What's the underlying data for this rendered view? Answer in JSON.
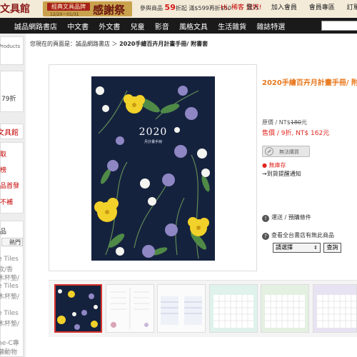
{
  "topbar": {
    "logo_fragment": "文具館",
    "event_ribbon": "經典文具品牌",
    "event_dates": "12/20－01/31",
    "event_title": "感謝祭",
    "promo_prefix": "參與商品",
    "promo_discount": "59",
    "promo_suffix": "折起",
    "promo_threshold": "滿$599再折$50",
    "greeting": "Hi, 稀客 您好!",
    "links": [
      "登入",
      "加入會員",
      "會員專區",
      "訂單查詢"
    ]
  },
  "nav": {
    "items": [
      "誠品網路書店",
      "中文書",
      "外文書",
      "兒童",
      "影音",
      "風格文具",
      "生活雜貨",
      "雜誌特選"
    ]
  },
  "sidebar": {
    "lines": [
      "Products",
      "79折",
      "文具館",
      "取",
      "榜",
      "品首發",
      "不補",
      "品",
      "熱門",
      "e Tiles",
      "款/香",
      "木杯墊/",
      "e Tiles",
      "木杯墊/",
      "e Tiles",
      "木杯墊/",
      "ne-C專",
      "懶動物"
    ]
  },
  "breadcrumb": {
    "prefix": "您現在的頁面是：誠品網路書店 ＞",
    "current": "2020手繪百卉月計畫手冊/ 附書套"
  },
  "cover": {
    "year": "2020",
    "subtitle": "月計畫手冊"
  },
  "product": {
    "title": "2020手繪百卉月計畫手冊/ 附",
    "original_label": "原價 / NT$",
    "original_price": "180",
    "original_suffix": "元",
    "sale_text": "售價 / 9折, NT$ 162元",
    "soldout_label": "無法購買",
    "stock_status": "● 無庫存",
    "notify_label": "→到貨提醒通知",
    "shipping_label": "運送 / 預購條件",
    "store_check_label": "查看全台書店有無此商品",
    "select_value": "請選擇",
    "query_button": "查詢"
  },
  "colors": {
    "accent_orange": "#e8771b",
    "price_red": "#e0261f",
    "nav_black": "#1a1a1a",
    "cover_navy": "#15223e"
  }
}
